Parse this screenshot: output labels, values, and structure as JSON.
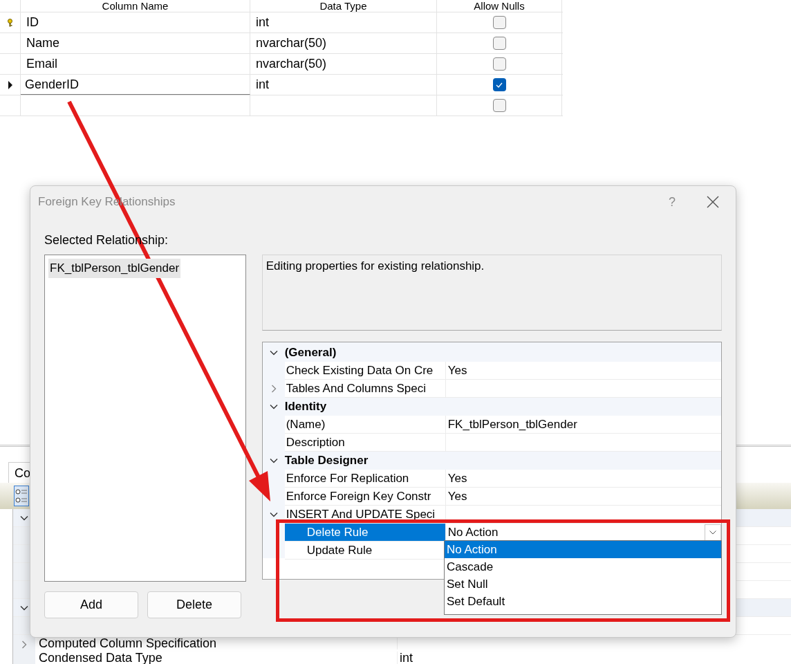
{
  "table_designer": {
    "columns": [
      "Column Name",
      "Data Type",
      "Allow Nulls"
    ],
    "rows": [
      {
        "kind": "key",
        "name": "ID",
        "data_type": "int",
        "allow_nulls": false
      },
      {
        "kind": "plain",
        "name": "Name",
        "data_type": "nvarchar(50)",
        "allow_nulls": false
      },
      {
        "kind": "plain",
        "name": "Email",
        "data_type": "nvarchar(50)",
        "allow_nulls": false
      },
      {
        "kind": "current",
        "name": "GenderID",
        "data_type": "int",
        "allow_nulls": true,
        "editing": true
      },
      {
        "kind": "plain",
        "allow_nulls": false
      }
    ]
  },
  "column_properties": {
    "tab": "Co",
    "rows": [
      {
        "kind": "category",
        "expanded": true
      },
      {
        "kind": "property"
      },
      {
        "kind": "property"
      },
      {
        "kind": "property"
      },
      {
        "kind": "property"
      },
      {
        "kind": "category",
        "expanded": true
      },
      {
        "kind": "property"
      },
      {
        "kind": "property",
        "label": "Computed Column Specification",
        "expanded": false
      },
      {
        "kind": "property",
        "label": "Condensed Data Type",
        "value": "int"
      }
    ]
  },
  "dialog": {
    "title": "Foreign Key Relationships",
    "help": "?",
    "list_label": "Selected Relationship:",
    "relationships": [
      {
        "label": "FK_tblPerson_tblGender",
        "selected": true
      }
    ],
    "buttons": [
      "Add",
      "Delete"
    ],
    "description": "Editing properties for existing relationship.",
    "properties": [
      {
        "kind": "category",
        "label": "(General)",
        "expanded": true
      },
      {
        "kind": "property",
        "label": "Check Existing Data On Cre",
        "value": "Yes"
      },
      {
        "kind": "property",
        "label": "Tables And Columns Speci",
        "expanded": false
      },
      {
        "kind": "category",
        "label": "Identity",
        "expanded": true
      },
      {
        "kind": "property",
        "label": "(Name)",
        "value": "FK_tblPerson_tblGender"
      },
      {
        "kind": "property",
        "label": "Description"
      },
      {
        "kind": "category",
        "label": "Table Designer",
        "expanded": true
      },
      {
        "kind": "property",
        "label": "Enforce For Replication",
        "value": "Yes"
      },
      {
        "kind": "property",
        "label": "Enforce Foreign Key Constr",
        "value": "Yes"
      },
      {
        "kind": "property",
        "label": "INSERT And UPDATE Speci",
        "expanded": true
      },
      {
        "kind": "subproperty",
        "label": "Delete Rule",
        "selected": true
      },
      {
        "kind": "subproperty",
        "label": "Update Rule",
        "selected": false
      }
    ],
    "dropdown": {
      "value": "No Action",
      "options": [
        {
          "label": "No Action",
          "selected": true
        },
        {
          "label": "Cascade",
          "selected": false
        },
        {
          "label": "Set Null",
          "selected": false
        },
        {
          "label": "Set Default",
          "selected": false
        }
      ]
    }
  }
}
